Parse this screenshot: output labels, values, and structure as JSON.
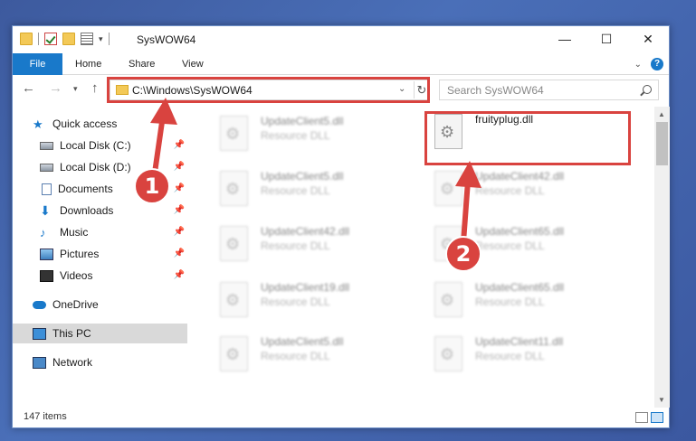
{
  "window": {
    "title": "SysWOW64",
    "controls": {
      "minimize": "—",
      "maximize": "☐",
      "close": "✕"
    }
  },
  "ribbon": {
    "tabs": [
      {
        "label": "File"
      },
      {
        "label": "Home"
      },
      {
        "label": "Share"
      },
      {
        "label": "View"
      }
    ],
    "help": "?"
  },
  "nav": {
    "address": "C:\\Windows\\SysWOW64",
    "search_placeholder": "Search SysWOW64"
  },
  "sidebar": {
    "items": [
      {
        "label": "Quick access",
        "icon": "star-icon"
      },
      {
        "label": "Local Disk (C:)",
        "icon": "disk-icon"
      },
      {
        "label": "Local Disk (D:)",
        "icon": "disk-icon"
      },
      {
        "label": "Documents",
        "icon": "documents-icon"
      },
      {
        "label": "Downloads",
        "icon": "download-icon"
      },
      {
        "label": "Music",
        "icon": "music-icon"
      },
      {
        "label": "Pictures",
        "icon": "pictures-icon"
      },
      {
        "label": "Videos",
        "icon": "videos-icon"
      },
      {
        "label": "OneDrive",
        "icon": "cloud-icon"
      },
      {
        "label": "This PC",
        "icon": "pc-icon"
      },
      {
        "label": "Network",
        "icon": "network-icon"
      }
    ]
  },
  "files": {
    "left": [
      {
        "name": "UpdateClient5.dll",
        "type": "Resource DLL"
      },
      {
        "name": "UpdateClient5.dll",
        "type": "Resource DLL"
      },
      {
        "name": "UpdateClient42.dll",
        "type": "Resource DLL"
      },
      {
        "name": "UpdateClient19.dll",
        "type": "Resource DLL"
      },
      {
        "name": "UpdateClient5.dll",
        "type": "Resource DLL"
      }
    ],
    "right": [
      {
        "name": "fruityplug.dll",
        "type": ""
      },
      {
        "name": "UpdateClient42.dll",
        "type": "Resource DLL"
      },
      {
        "name": "UpdateClient65.dll",
        "type": "Resource DLL"
      },
      {
        "name": "UpdateClient65.dll",
        "type": "Resource DLL"
      },
      {
        "name": "UpdateClient11.dll",
        "type": "Resource DLL"
      }
    ]
  },
  "status": {
    "item_count": "147 items"
  },
  "annotations": {
    "step1": "1",
    "step2": "2",
    "color": "#d9433f"
  }
}
